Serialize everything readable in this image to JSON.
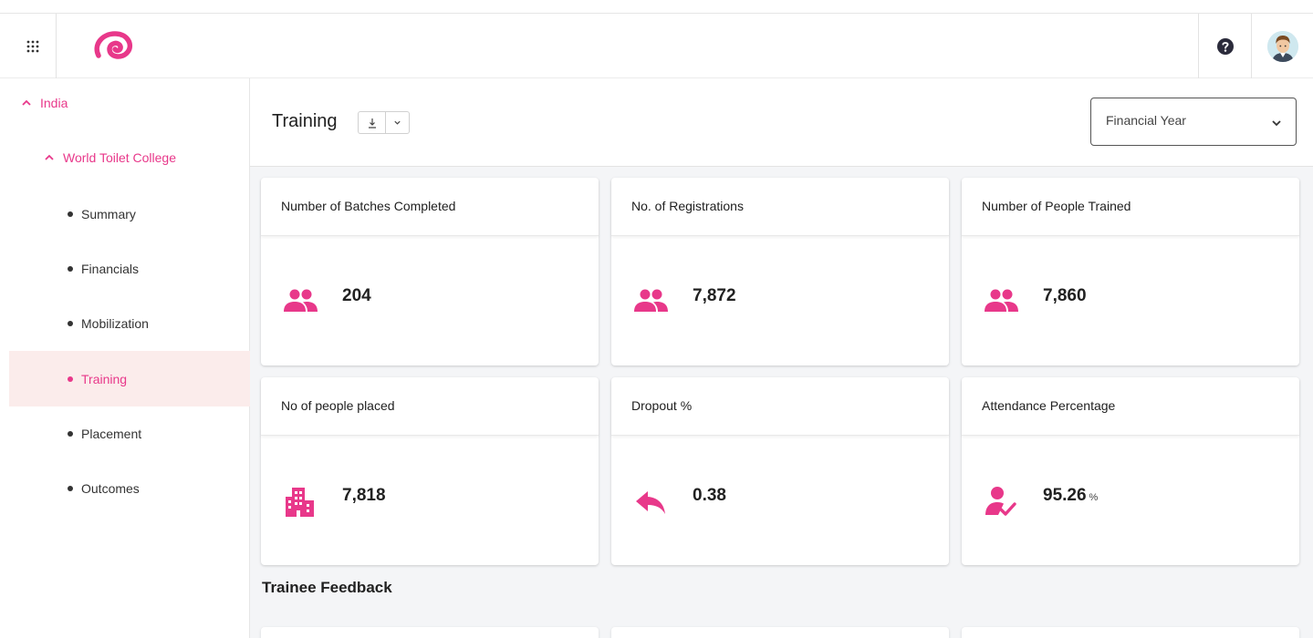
{
  "sidebar": {
    "country": "India",
    "organization": "World Toilet College",
    "items": [
      {
        "label": "Summary"
      },
      {
        "label": "Financials"
      },
      {
        "label": "Mobilization"
      },
      {
        "label": "Training"
      },
      {
        "label": "Placement"
      },
      {
        "label": "Outcomes"
      }
    ],
    "active_item": "Training"
  },
  "header": {
    "title": "Training",
    "download_icon": "download-icon",
    "filter": {
      "label": "Financial Year"
    }
  },
  "cards": [
    {
      "title": "Number of Batches Completed",
      "value": "204",
      "icon": "people-icon"
    },
    {
      "title": "No. of Registrations",
      "value": "7,872",
      "icon": "people-icon"
    },
    {
      "title": "Number of People Trained",
      "value": "7,860",
      "icon": "people-icon"
    },
    {
      "title": "No of people placed",
      "value": "7,818",
      "icon": "building-icon"
    },
    {
      "title": "Dropout %",
      "value": "0.38",
      "icon": "reply-arrow-icon"
    },
    {
      "title": "Attendance Percentage",
      "value": "95.26",
      "unit": "%",
      "icon": "person-check-icon"
    }
  ],
  "section": {
    "title": "Trainee Feedback"
  },
  "colors": {
    "accent": "#e8388a",
    "active_bg": "#fbeceb",
    "page_bg": "#f4f5f7"
  }
}
